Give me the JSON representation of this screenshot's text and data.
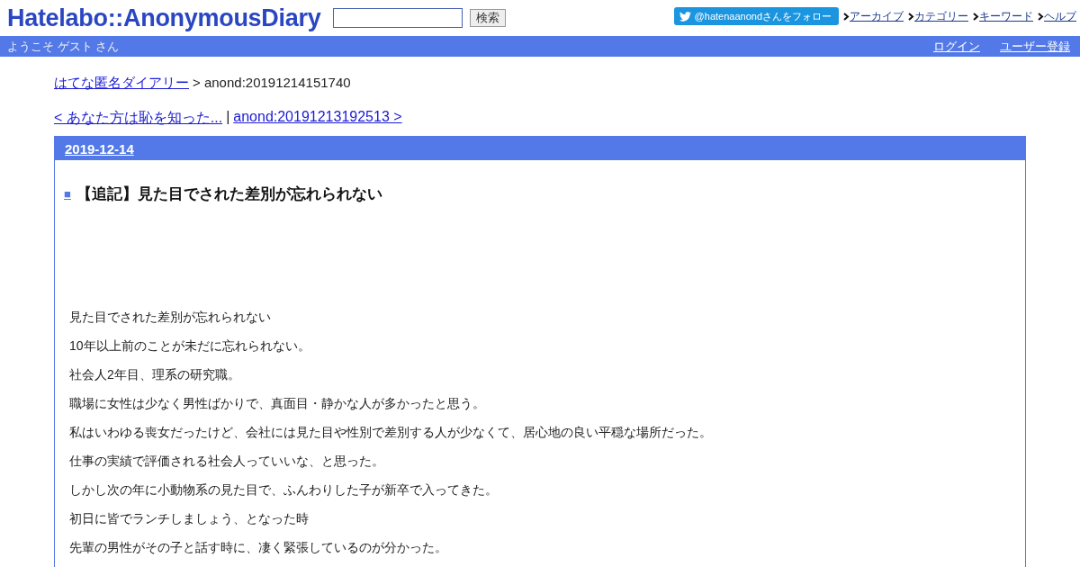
{
  "header": {
    "logo": "Hatelabo::AnonymousDiary",
    "search": {
      "button": "検索"
    },
    "twitter_button": "@hatenaanondさんをフォロー",
    "nav": [
      "アーカイブ",
      "カテゴリー",
      "キーワード",
      "ヘルプ"
    ]
  },
  "user_bar": {
    "greeting": "ようこそ ゲスト さん",
    "links": [
      "ログイン",
      "ユーザー登録"
    ]
  },
  "breadcrumb": {
    "link": "はてな匿名ダイアリー",
    "current": "> anond:20191214151740"
  },
  "pager": {
    "prev": "< あなた方は恥を知った...",
    "separator": "|",
    "next": "anond:20191213192513 >"
  },
  "day": {
    "date": "2019-12-14",
    "section_mark": "■",
    "title": "【追記】見た目でされた差別が忘れられない",
    "paragraphs": [
      "見た目でされた差別が忘れられない",
      "10年以上前のことが未だに忘れられない。",
      "社会人2年目、理系の研究職。",
      "職場に女性は少なく男性ばかりで、真面目・静かな人が多かったと思う。",
      "私はいわゆる喪女だったけど、会社には見た目や性別で差別する人が少なくて、居心地の良い平穏な場所だった。",
      "仕事の実績で評価される社会人っていいな、と思った。",
      "しかし次の年に小動物系の見た目で、ふんわりした子が新卒で入ってきた。",
      "初日に皆でランチしましょう、となった時",
      "先輩の男性がその子と話す時に、凄く緊張しているのが分かった。"
    ]
  }
}
